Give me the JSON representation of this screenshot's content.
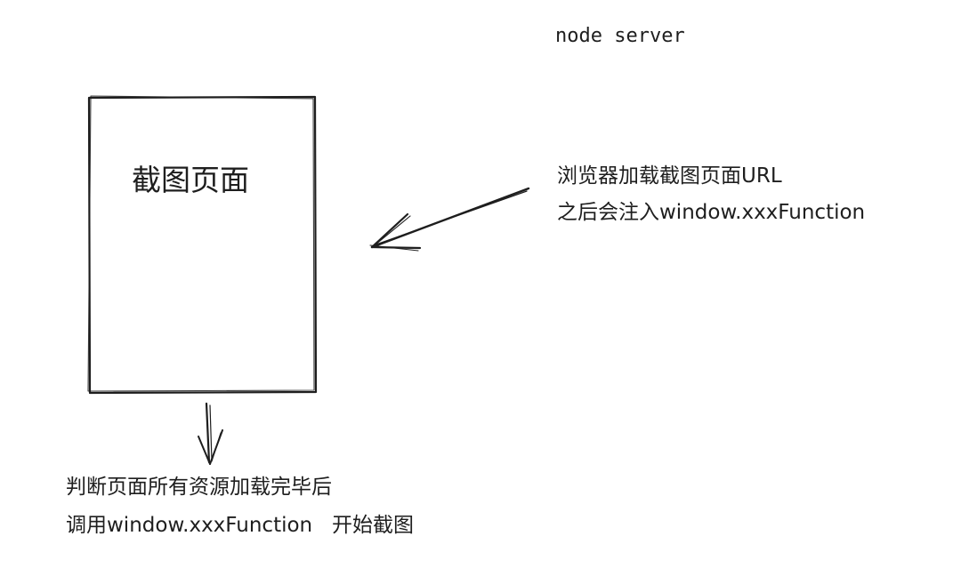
{
  "title": "node server",
  "page_box": {
    "label": "截图页面"
  },
  "injection_note": {
    "line1": "浏览器加载截图页面URL",
    "line2": "之后会注入window.xxxFunction"
  },
  "screenshot_note": {
    "line1": "判断页面所有资源加载完毕后",
    "line2": "调用window.xxxFunction   开始截图"
  },
  "colors": {
    "ink": "#1e1e1e",
    "background": "#ffffff"
  }
}
